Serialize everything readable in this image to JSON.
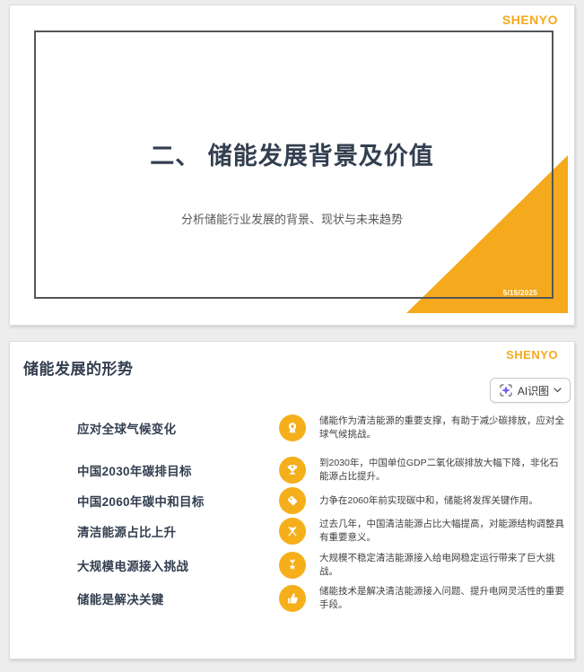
{
  "brand": {
    "logo": "SHENYO",
    "accent_color": "#F5A91D",
    "navy_color": "#333F50",
    "icon_circle_color": "#F5AF1B",
    "ai_icon_color": "#7C5CF0"
  },
  "slide1": {
    "logo": "SHENYO",
    "title": "二、 储能发展背景及价值",
    "subtitle": "分析储能行业发展的背景、现状与未来趋势",
    "date": "5/15/2025"
  },
  "slide2": {
    "logo": "SHENYO",
    "title": "储能发展的形势",
    "ai_button": {
      "label": "AI识图",
      "icon": "ai-sparkle-scan-icon",
      "chevron": "chevron-down-icon"
    },
    "items": [
      {
        "label": "应对全球气候变化",
        "icon": "award-rosette-icon",
        "desc": "储能作为清洁能源的重要支撑，有助于减少碳排放，应对全球气候挑战。"
      },
      {
        "label": "中国2030年碳排目标",
        "icon": "trophy-icon",
        "desc": "到2030年，中国单位GDP二氧化碳排放大幅下降，非化石能源占比提升。"
      },
      {
        "label": "中国2060年碳中和目标",
        "icon": "tag-icon",
        "desc": "力争在2060年前实现碳中和，储能将发挥关键作用。"
      },
      {
        "label": "清洁能源占比上升",
        "icon": "crossed-flags-icon",
        "desc": "过去几年，中国清洁能源占比大幅提高，对能源结构调整具有重要意义。"
      },
      {
        "label": "大规模电源接入挑战",
        "icon": "medal-star-icon",
        "desc": "大规模不稳定清洁能源接入给电网稳定运行带来了巨大挑战。"
      },
      {
        "label": "储能是解决关键",
        "icon": "thumbs-up-icon",
        "desc": "储能技术是解决清洁能源接入问题、提升电网灵活性的重要手段。"
      }
    ]
  }
}
